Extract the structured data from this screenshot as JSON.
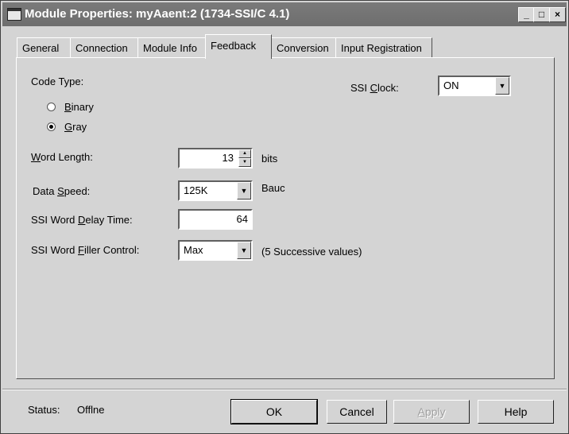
{
  "window": {
    "title": "Module Properties: myAaent:2 (1734-SSI/C 4.1)",
    "controls": {
      "minimize": "_",
      "maximize": "□",
      "close": "×"
    }
  },
  "tabs": [
    {
      "label": "General"
    },
    {
      "label": "Connection"
    },
    {
      "label": "Module Info"
    },
    {
      "label": "Feedback"
    },
    {
      "label": "Conversion"
    },
    {
      "label": "Input Registration"
    }
  ],
  "active_tab": "Feedback",
  "feedback": {
    "code_type_label": "Code Type:",
    "binary_label": "Binary",
    "gray_label": "Gray",
    "selected_code_type": "Gray",
    "ssi_clock_label": "SSI Clock:",
    "ssi_clock_value": "ON",
    "word_length_label": "Word Length:",
    "word_length_value": "13",
    "word_length_unit": "bits",
    "data_speed_label": "Data Speed:",
    "data_speed_value": "125K",
    "data_speed_unit": "Bauc",
    "delay_time_label": "SSI Word Delay Time:",
    "delay_time_value": "64",
    "filler_control_label": "SSI Word Filler Control:",
    "filler_control_value": "Max",
    "filler_control_note": "(5 Successive values)"
  },
  "footer": {
    "status_label": "Status:",
    "status_value": "Offlne",
    "ok_label": "OK",
    "cancel_label": "Cancel",
    "apply_label": "Apply",
    "help_label": "Help"
  }
}
